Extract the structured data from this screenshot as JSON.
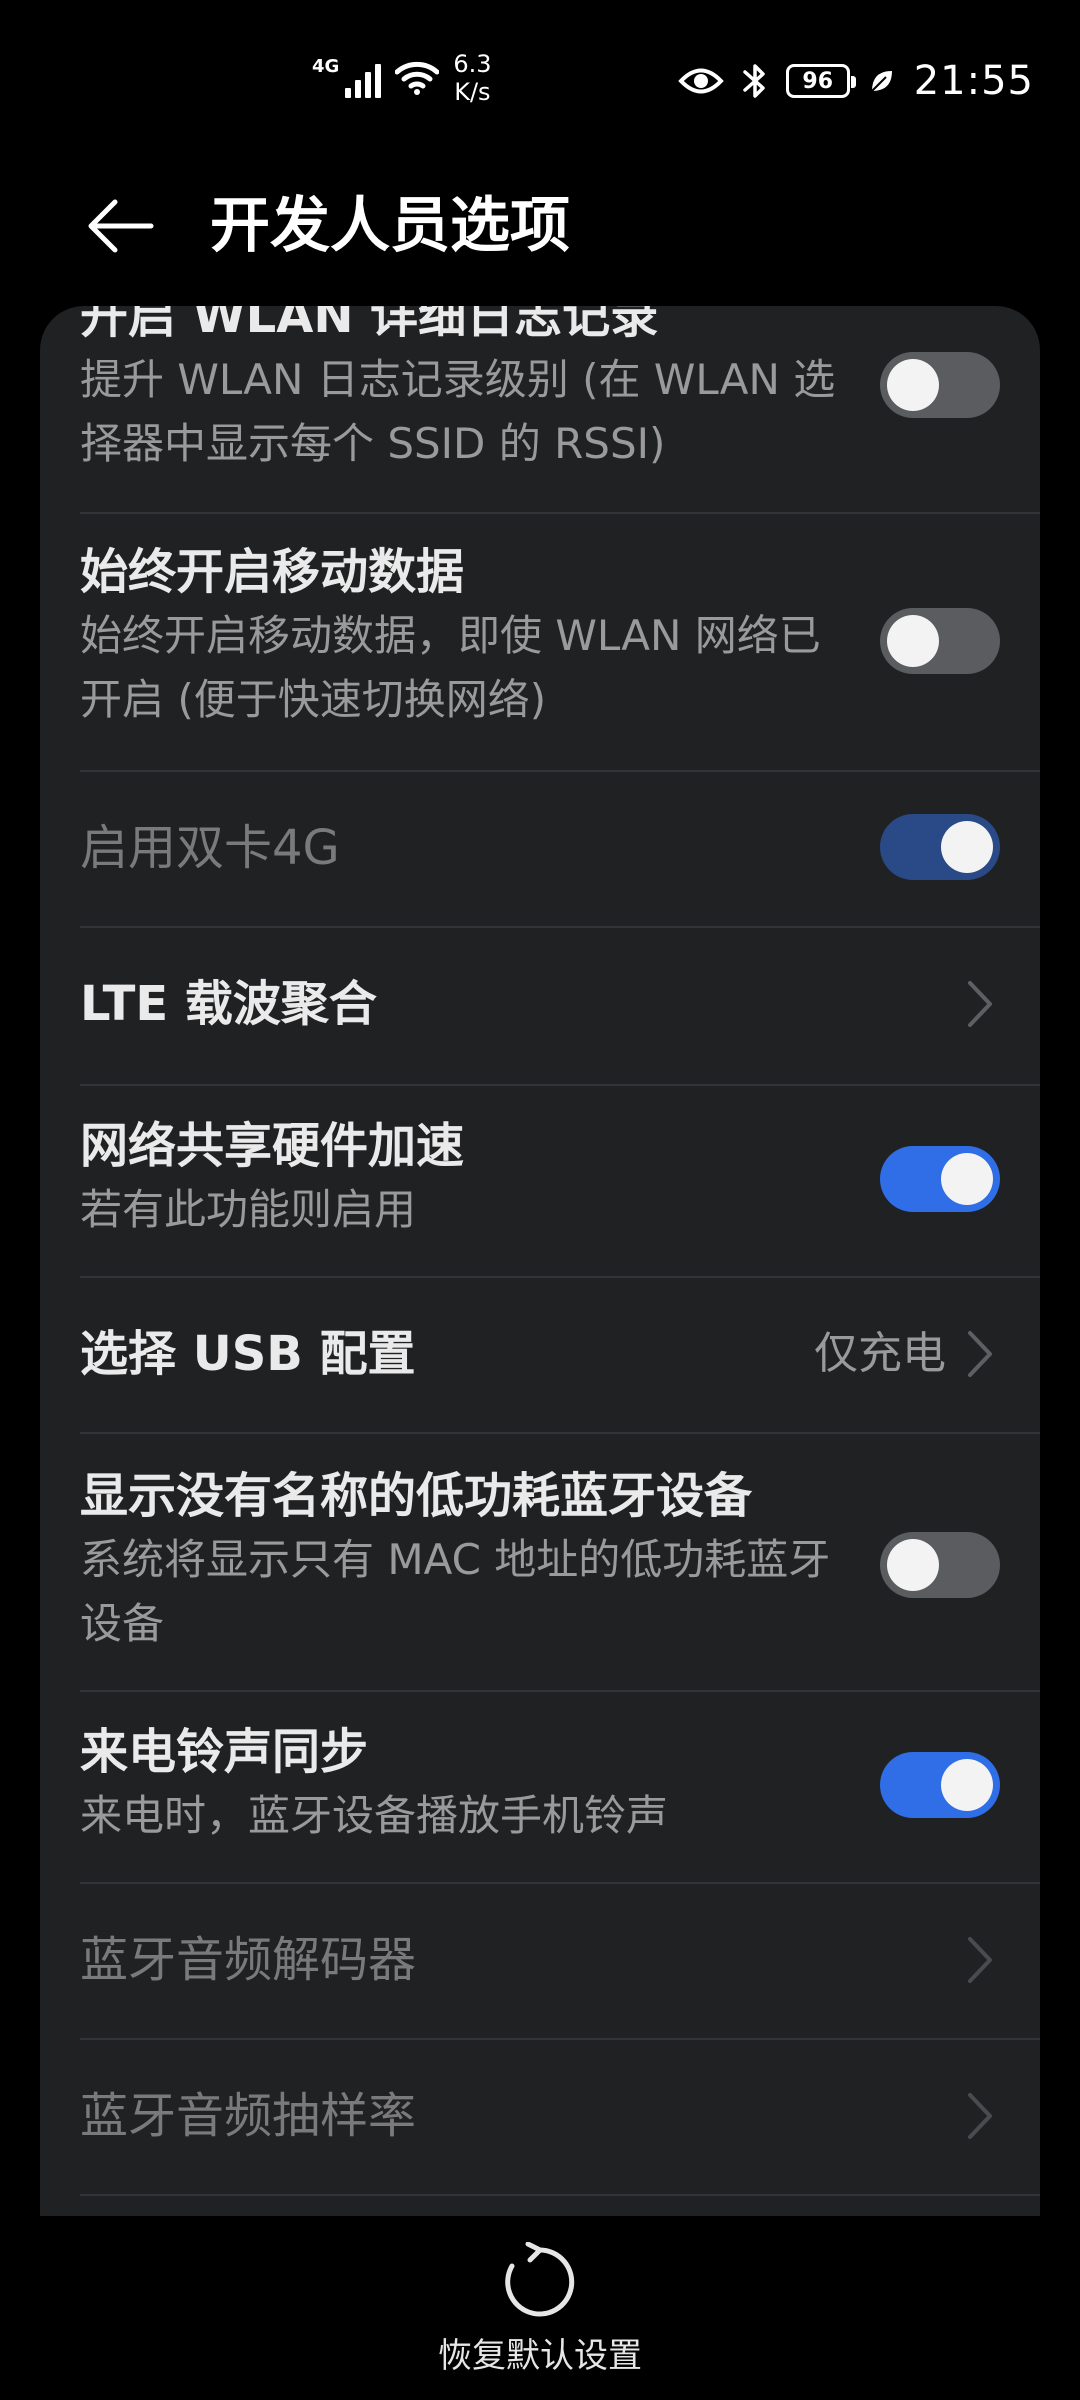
{
  "status": {
    "net_type": "4G",
    "speed_value": "6.3",
    "speed_unit": "K/s",
    "battery": "96",
    "time": "21:55"
  },
  "header": {
    "title": "开发人员选项"
  },
  "items": [
    {
      "title": "开启 WLAN 详细日志记录",
      "subtitle": "提升 WLAN 日志记录级别 (在 WLAN 选择器中显示每个 SSID 的 RSSI)",
      "control": "toggle",
      "state": "off"
    },
    {
      "title": "始终开启移动数据",
      "subtitle": "始终开启移动数据，即使 WLAN 网络已开启 (便于快速切换网络)",
      "control": "toggle",
      "state": "off"
    },
    {
      "title": "启用双卡4G",
      "control": "toggle",
      "state": "on",
      "disabled": true
    },
    {
      "title": "LTE 载波聚合",
      "control": "chevron"
    },
    {
      "title": "网络共享硬件加速",
      "subtitle": "若有此功能则启用",
      "control": "toggle",
      "state": "on"
    },
    {
      "title": "选择 USB 配置",
      "value": "仅充电",
      "control": "chevron"
    },
    {
      "title": "显示没有名称的低功耗蓝牙设备",
      "subtitle": "系统将显示只有 MAC 地址的低功耗蓝牙设备",
      "control": "toggle",
      "state": "off"
    },
    {
      "title": "来电铃声同步",
      "subtitle": "来电时，蓝牙设备播放手机铃声",
      "control": "toggle",
      "state": "on"
    },
    {
      "title": "蓝牙音频解码器",
      "control": "chevron",
      "disabled": true
    },
    {
      "title": "蓝牙音频抽样率",
      "control": "chevron",
      "disabled": true
    }
  ],
  "footer": {
    "reset_label": "恢复默认设置"
  },
  "colors": {
    "accent": "#2f6ee6",
    "card_bg": "#202123",
    "toggle_off": "#5b5c5f"
  }
}
